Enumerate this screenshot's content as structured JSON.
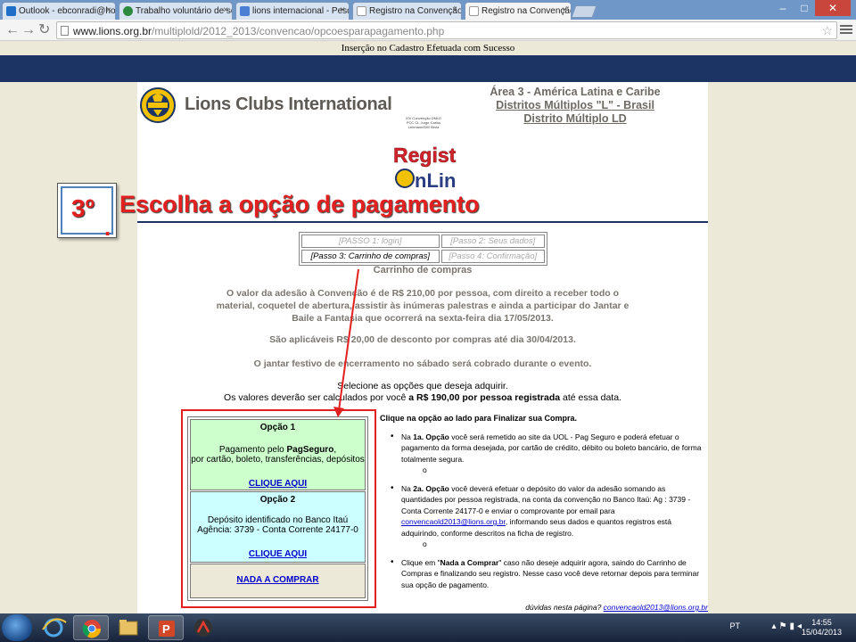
{
  "browser": {
    "tabs": [
      {
        "label": "Outlook - ebconradi@hot",
        "color": "#1f6fc8"
      },
      {
        "label": "Trabalho voluntário de se",
        "color": "#2b8a3e"
      },
      {
        "label": "lions internacional - Pesq",
        "color": "#4a7fd4"
      },
      {
        "label": "Registro na Convenção Dl",
        "color": "#cccccc"
      },
      {
        "label": "Registro na Convenção Dl",
        "color": "#cccccc",
        "active": true
      }
    ],
    "url_host": "www.lions.org.br",
    "url_path": "/multiplold/2012_2013/convencao/opcoesparapagamento.php"
  },
  "page": {
    "success_msg": "Inserção no Cadastro Efetuada com Sucesso",
    "brand": "Lions Clubs International",
    "area_line1": "Área 3 - América Latina e Caribe",
    "area_line2": "Distritos Múltiplos \"L\" - Brasil",
    "area_line3": "Distrito Múltiplo LD",
    "conv_small_1": "XIV Convenção DMLD",
    "conv_small_2": "PCC CL Jorge Carlos Lehmann/DM Silvia",
    "registro_top": "Registro",
    "registro_bottom": "nLine",
    "steps": {
      "step1": "[PASSO 1: login]",
      "step2": "[Passo 2: Seus dados]",
      "step3": "[Passo 3: Carrinho de compras]",
      "step4": "[Passo 4: Confirmação]"
    },
    "cart_title": "Carrinho de compras",
    "para1": "O valor da adesão à Convenção é de R$ 210,00  por pessoa, com direito a receber todo o material, coquetel de abertura, assistir às inúmeras palestras e ainda a participar do Jantar e Baile a Fantasia que ocorrerá na sexta-feira dia 17/05/2013.",
    "para2": "São aplicáveis R$ 20,00 de desconto por compras até dia 30/04/2013.",
    "para3": "O jantar festivo de encerramento no sábado será cobrado durante o evento.",
    "select_line": "Selecione as opções que deseja adquirir.",
    "values_pre": "Os valores deverão ser calculados por você",
    "values_bold": "a R$ 190,00 por pessoa registrada",
    "values_post": "até essa data.",
    "option1": {
      "title": "Opção 1",
      "line1_pre": "Pagamento pelo ",
      "line1_bold": "PagSeguro",
      "line1_post": ",",
      "line2": "por cartão, boleto, transferências, depósitos",
      "link": "CLIQUE AQUI"
    },
    "option2": {
      "title": "Opção 2",
      "line1": "Depósito identificado no Banco Itaú",
      "line2": "Agência: 3739 - Conta Corrente 24177-0",
      "link": "CLIQUE AQUI"
    },
    "option3": {
      "link": "NADA A COMPRAR"
    },
    "right_heading": "Clique na opção ao lado para Finalizar sua Compra.",
    "b1_pre": "Na ",
    "b1_bold": "1a. Opção",
    "b1_post": " você será remetido ao site da UOL - Pag Seguro e poderá efetuar o pagamento da forma desejada, por cartão de crédito, débito ou boleto bancário, de forma totalmente segura.",
    "b2_pre": "Na ",
    "b2_bold": "2a. Opção",
    "b2_mid": " você deverá efetuar o depósito do valor da adesão somando as quantidades por pessoa registrada, na conta da convenção no Banco Itaú: Ag : 3739 - Conta Corrente 24177-0 e enviar o comprovante por email para ",
    "b2_email": "convencaold2013@lions.org.br",
    "b2_post": ", informando seus dados e quantos registros está adquirindo, conforme descritos na ficha de registro.",
    "b3_pre": "Clique em \"",
    "b3_bold": "Nada a Comprar",
    "b3_post": "\" caso não deseje adquirir agora, saindo do Carrinho de Compras e finalizando seu registro. Nesse caso você deve retornar depois para terminar sua opção de pagamento.",
    "circle": "o",
    "duvidas_pre": "dúvidas nesta página? ",
    "duvidas_email": "convencaold2013@lions.org.br"
  },
  "overlay": {
    "step_number": "3º",
    "step_dot": ".",
    "title": "Escolha a opção de pagamento"
  },
  "taskbar": {
    "lang": "PT",
    "time": "14:55",
    "date": "15/04/2013"
  },
  "colors": {
    "overlay_red": "#e2201f",
    "navy": "#1c3464",
    "option1_bg": "#ccffcc",
    "option2_bg": "#ccffff"
  }
}
